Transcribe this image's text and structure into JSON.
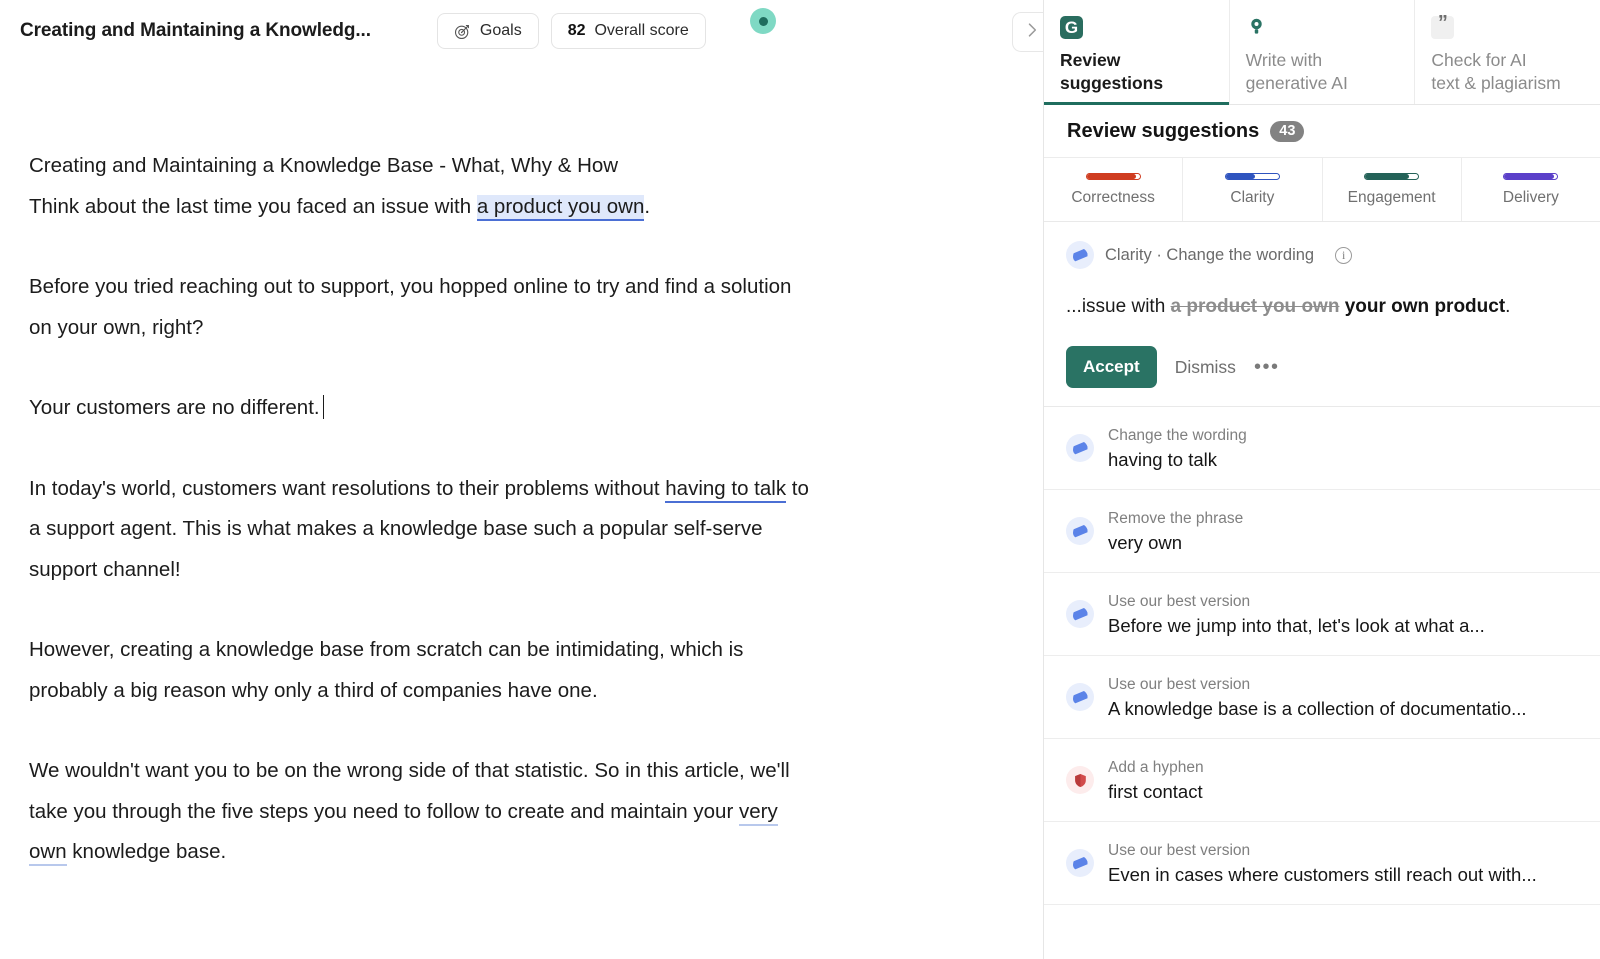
{
  "editor": {
    "title": "Creating and Maintaining a Knowledg...",
    "goals_label": "Goals",
    "goals_icon": "target-icon",
    "score_value": "82",
    "score_label": "Overall score",
    "collapse_icon": "chevron-right-icon",
    "paragraphs": [
      {
        "id": "p1",
        "runs": [
          {
            "text": "Creating and Maintaining a Knowledge Base - What, Why & How",
            "style": "plain"
          },
          {
            "text": "\n",
            "style": "br"
          },
          {
            "text": "Think about the last time you faced an issue with ",
            "style": "plain"
          },
          {
            "text": "a product you own",
            "style": "highlight-box"
          },
          {
            "text": ".",
            "style": "plain"
          }
        ]
      },
      {
        "id": "p2",
        "runs": [
          {
            "text": "Before you tried reaching out to support, you hopped online to try and find a solution on your own, right?",
            "style": "plain"
          }
        ]
      },
      {
        "id": "p3",
        "runs": [
          {
            "text": "Your customers are no different.",
            "style": "plain"
          },
          {
            "text": "",
            "style": "caret"
          }
        ]
      },
      {
        "id": "p4",
        "runs": [
          {
            "text": "In today's world, customers want resolutions to their problems without ",
            "style": "plain"
          },
          {
            "text": "having to talk",
            "style": "underline-strong"
          },
          {
            "text": " to a support agent. This is what makes a knowledge base such a popular self-serve support channel!",
            "style": "plain"
          }
        ]
      },
      {
        "id": "p5",
        "runs": [
          {
            "text": "However, creating a knowledge base from scratch can be intimidating, which is probably a big reason why only a third of companies have one.",
            "style": "plain"
          }
        ]
      },
      {
        "id": "p6",
        "runs": [
          {
            "text": "We wouldn't want you to be on the wrong side of that statistic. So in this article, we'll",
            "style": "plain"
          },
          {
            "text": "\n",
            "style": "br"
          },
          {
            "text": "take you through the five steps you need to follow to create and maintain your ",
            "style": "plain"
          },
          {
            "text": "very own",
            "style": "underline-light"
          },
          {
            "text": " knowledge base.",
            "style": "plain"
          }
        ]
      }
    ]
  },
  "sidebar": {
    "tabs": [
      {
        "id": "review",
        "icon": "grammarly-g-icon",
        "label": "Review\nsuggestions",
        "active": true
      },
      {
        "id": "generative",
        "icon": "lightbulb-icon",
        "label": "Write with\ngenerative AI",
        "active": false
      },
      {
        "id": "plagiarism",
        "icon": "quote-icon",
        "label": "Check for AI\ntext & plagiarism",
        "active": false
      }
    ],
    "panel_title": "Review suggestions",
    "panel_count": "43",
    "categories": [
      {
        "name": "Correctness",
        "color": "#cf3c20",
        "fill_pct": 93
      },
      {
        "name": "Clarity",
        "color": "#2f54bf",
        "fill_pct": 55
      },
      {
        "name": "Engagement",
        "color": "#246258",
        "fill_pct": 82
      },
      {
        "name": "Delivery",
        "color": "#5b40c9",
        "fill_pct": 94
      }
    ],
    "active_suggestion": {
      "category": "Clarity",
      "kind": "Change the wording",
      "header_text": "Clarity · Change the wording",
      "icon": "clarity-dot-icon",
      "info_icon": "info-icon",
      "prefix": "...issue with ",
      "deleted": "a product you own",
      "inserted": " your own product",
      "suffix": ".",
      "accept_label": "Accept",
      "dismiss_label": "Dismiss",
      "more_label": "•••"
    },
    "suggestions": [
      {
        "kind": "Change the wording",
        "text": "having to talk",
        "icon": "clarity-dot-icon",
        "tone": "blue"
      },
      {
        "kind": "Remove the phrase",
        "text": "very own",
        "icon": "clarity-dot-icon",
        "tone": "blue"
      },
      {
        "kind": "Use our best version",
        "text": "Before we jump into that, let's look at what a...",
        "icon": "clarity-dot-icon",
        "tone": "blue"
      },
      {
        "kind": "Use our best version",
        "text": "A knowledge base is a collection of documentatio...",
        "icon": "clarity-dot-icon",
        "tone": "blue"
      },
      {
        "kind": "Add a hyphen",
        "text": "first contact",
        "icon": "correctness-shield-icon",
        "tone": "red"
      },
      {
        "kind": "Use our best version",
        "text": "Even in cases where customers still reach out with...",
        "icon": "clarity-dot-icon",
        "tone": "blue"
      }
    ]
  }
}
